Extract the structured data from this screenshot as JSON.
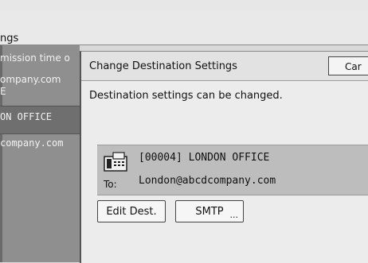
{
  "background": {
    "title": "ngs",
    "rows": [
      "mission time o",
      "ompany.com",
      "E",
      "ON OFFICE",
      "company.com"
    ]
  },
  "dialog": {
    "title": "Change Destination Settings",
    "cancel_label": "Car",
    "message": "Destination settings can be changed.",
    "destination": {
      "icon": "fax-icon",
      "id_name": "[00004] LONDON OFFICE",
      "to_label": "To:",
      "email": "London@abcdcompany.com"
    },
    "buttons": {
      "edit_dest": "Edit Dest.",
      "smtp": "SMTP",
      "smtp_more": "..."
    }
  }
}
